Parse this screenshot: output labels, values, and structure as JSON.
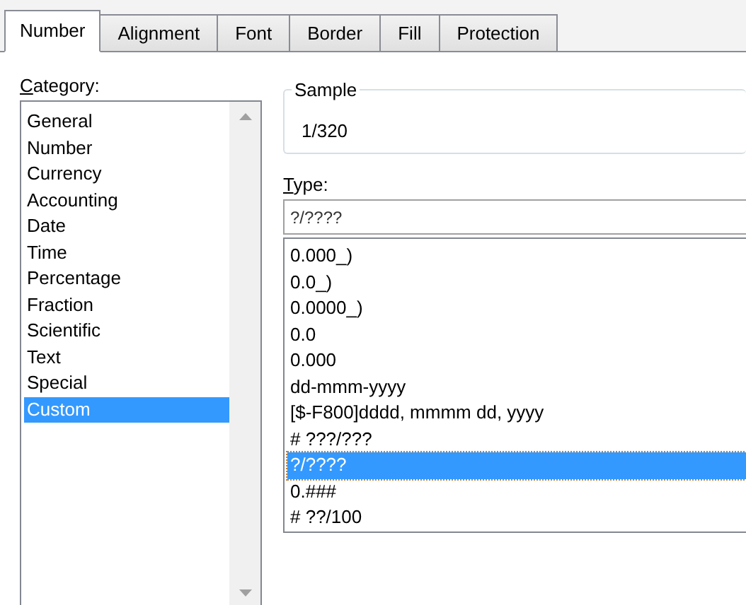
{
  "tabs": [
    {
      "label": "Number",
      "selected": true
    },
    {
      "label": "Alignment",
      "selected": false
    },
    {
      "label": "Font",
      "selected": false
    },
    {
      "label": "Border",
      "selected": false
    },
    {
      "label": "Fill",
      "selected": false
    },
    {
      "label": "Protection",
      "selected": false
    }
  ],
  "category": {
    "label": "Category:",
    "items": [
      {
        "label": "General",
        "selected": false
      },
      {
        "label": "Number",
        "selected": false
      },
      {
        "label": "Currency",
        "selected": false
      },
      {
        "label": "Accounting",
        "selected": false
      },
      {
        "label": "Date",
        "selected": false
      },
      {
        "label": "Time",
        "selected": false
      },
      {
        "label": "Percentage",
        "selected": false
      },
      {
        "label": "Fraction",
        "selected": false
      },
      {
        "label": "Scientific",
        "selected": false
      },
      {
        "label": "Text",
        "selected": false
      },
      {
        "label": "Special",
        "selected": false
      },
      {
        "label": "Custom",
        "selected": true
      }
    ]
  },
  "sample": {
    "label": "Sample",
    "value": "1/320"
  },
  "type": {
    "label": "Type:",
    "value": "?/????",
    "items": [
      {
        "label": "0.000_)",
        "selected": false
      },
      {
        "label": "0.0_)",
        "selected": false
      },
      {
        "label": "0.0000_)",
        "selected": false
      },
      {
        "label": "0.0",
        "selected": false
      },
      {
        "label": "0.000",
        "selected": false
      },
      {
        "label": "dd-mmm-yyyy",
        "selected": false
      },
      {
        "label": "[$-F800]dddd, mmmm dd, yyyy",
        "selected": false
      },
      {
        "label": "# ???/???",
        "selected": false
      },
      {
        "label": "?/????",
        "selected": true
      },
      {
        "label": "0.###",
        "selected": false
      },
      {
        "label": "# ??/100",
        "selected": false
      }
    ]
  }
}
